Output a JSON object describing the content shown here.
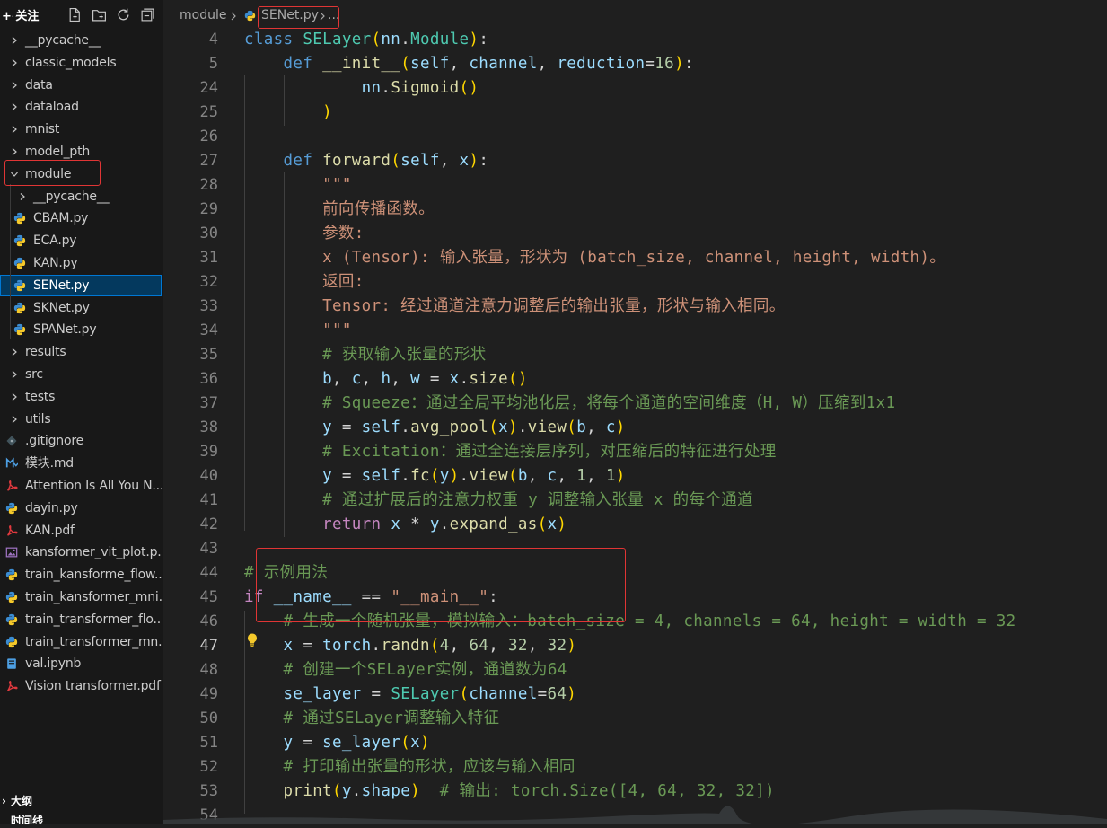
{
  "sidebar": {
    "brand": "+ 关注",
    "brand_ghost": "…",
    "header_icons": [
      "new-file-icon",
      "new-folder-icon",
      "refresh-icon",
      "collapse-all-icon"
    ],
    "tree": [
      {
        "label": "__pycache__",
        "kind": "folder",
        "expanded": false,
        "depth": 0
      },
      {
        "label": "classic_models",
        "kind": "folder",
        "expanded": false,
        "depth": 0
      },
      {
        "label": "data",
        "kind": "folder",
        "expanded": false,
        "depth": 0
      },
      {
        "label": "dataload",
        "kind": "folder",
        "expanded": false,
        "depth": 0
      },
      {
        "label": "mnist",
        "kind": "folder",
        "expanded": false,
        "depth": 0
      },
      {
        "label": "model_pth",
        "kind": "folder",
        "expanded": false,
        "depth": 0
      },
      {
        "label": "module",
        "kind": "folder",
        "expanded": true,
        "depth": 0
      },
      {
        "label": "__pycache__",
        "kind": "folder",
        "expanded": false,
        "depth": 1
      },
      {
        "label": "CBAM.py",
        "kind": "python",
        "depth": 1
      },
      {
        "label": "ECA.py",
        "kind": "python",
        "depth": 1
      },
      {
        "label": "KAN.py",
        "kind": "python",
        "depth": 1
      },
      {
        "label": "SENet.py",
        "kind": "python",
        "depth": 1,
        "selected": true
      },
      {
        "label": "SKNet.py",
        "kind": "python",
        "depth": 1
      },
      {
        "label": "SPANet.py",
        "kind": "python",
        "depth": 1
      },
      {
        "label": "results",
        "kind": "folder",
        "expanded": false,
        "depth": 0
      },
      {
        "label": "src",
        "kind": "folder",
        "expanded": false,
        "depth": 0
      },
      {
        "label": "tests",
        "kind": "folder",
        "expanded": false,
        "depth": 0
      },
      {
        "label": "utils",
        "kind": "folder",
        "expanded": false,
        "depth": 0
      },
      {
        "label": ".gitignore",
        "kind": "git",
        "depth": 0
      },
      {
        "label": "模块.md",
        "kind": "markdown",
        "depth": 0
      },
      {
        "label": "Attention Is All You N...",
        "kind": "pdf",
        "depth": 0
      },
      {
        "label": "dayin.py",
        "kind": "python",
        "depth": 0
      },
      {
        "label": "KAN.pdf",
        "kind": "pdf",
        "depth": 0
      },
      {
        "label": "kansformer_vit_plot.p...",
        "kind": "image",
        "depth": 0
      },
      {
        "label": "train_kansforme_flow...",
        "kind": "python",
        "depth": 0
      },
      {
        "label": "train_kansformer_mni...",
        "kind": "python",
        "depth": 0
      },
      {
        "label": "train_transformer_flo...",
        "kind": "python",
        "depth": 0
      },
      {
        "label": "train_transformer_mn...",
        "kind": "python",
        "depth": 0
      },
      {
        "label": "val.ipynb",
        "kind": "notebook",
        "depth": 0
      },
      {
        "label": "Vision transformer.pdf",
        "kind": "pdf",
        "depth": 0
      }
    ],
    "outline_label": "大纲",
    "timeline_label": "时间线"
  },
  "breadcrumb": {
    "folder": "module",
    "file": "SENet.py",
    "more": "..."
  },
  "editor": {
    "active_line": "47",
    "lines": [
      {
        "n": "4",
        "text": "class SELayer(nn.Module):"
      },
      {
        "n": "5",
        "text": "    def __init__(self, channel, reduction=16):"
      },
      {
        "n": "24",
        "text": "            nn.Sigmoid()"
      },
      {
        "n": "25",
        "text": "        )"
      },
      {
        "n": "26",
        "text": ""
      },
      {
        "n": "27",
        "text": "    def forward(self, x):"
      },
      {
        "n": "28",
        "text": "        \"\"\""
      },
      {
        "n": "29",
        "text": "        前向传播函数。"
      },
      {
        "n": "30",
        "text": "        参数:"
      },
      {
        "n": "31",
        "text": "        x (Tensor): 输入张量，形状为 (batch_size, channel, height, width)。"
      },
      {
        "n": "32",
        "text": "        返回:"
      },
      {
        "n": "33",
        "text": "        Tensor: 经过通道注意力调整后的输出张量，形状与输入相同。"
      },
      {
        "n": "34",
        "text": "        \"\"\""
      },
      {
        "n": "35",
        "text": "        # 获取输入张量的形状"
      },
      {
        "n": "36",
        "text": "        b, c, h, w = x.size()"
      },
      {
        "n": "37",
        "text": "        # Squeeze：通过全局平均池化层，将每个通道的空间维度（H, W）压缩到1x1"
      },
      {
        "n": "38",
        "text": "        y = self.avg_pool(x).view(b, c)"
      },
      {
        "n": "39",
        "text": "        # Excitation：通过全连接层序列，对压缩后的特征进行处理"
      },
      {
        "n": "40",
        "text": "        y = self.fc(y).view(b, c, 1, 1)"
      },
      {
        "n": "41",
        "text": "        # 通过扩展后的注意力权重 y 调整输入张量 x 的每个通道"
      },
      {
        "n": "42",
        "text": "        return x * y.expand_as(x)"
      },
      {
        "n": "43",
        "text": ""
      },
      {
        "n": "44",
        "text": "# 示例用法"
      },
      {
        "n": "45",
        "text": "if __name__ == \"__main__\":"
      },
      {
        "n": "46",
        "text": "    # 生成一个随机张量，模拟输入：batch_size = 4, channels = 64, height = width = 32"
      },
      {
        "n": "47",
        "text": "    x = torch.randn(4, 64, 32, 32)"
      },
      {
        "n": "48",
        "text": "    # 创建一个SELayer实例，通道数为64"
      },
      {
        "n": "49",
        "text": "    se_layer = SELayer(channel=64)"
      },
      {
        "n": "50",
        "text": "    # 通过SELayer调整输入特征"
      },
      {
        "n": "51",
        "text": "    y = se_layer(x)"
      },
      {
        "n": "52",
        "text": "    # 打印输出张量的形状，应该与输入相同"
      },
      {
        "n": "53",
        "text": "    print(y.shape)  # 输出: torch.Size([4, 64, 32, 32])"
      },
      {
        "n": "54",
        "text": ""
      }
    ]
  },
  "colors": {
    "editor_bg": "#1f1f1f",
    "sidebar_bg": "#181818",
    "selection": "#04395e",
    "annotation_red": "#e03535",
    "keyword": "#569cd6",
    "class": "#4ec9b0",
    "function": "#dcdcaa",
    "variable": "#9cdcfe",
    "number": "#b5cea8",
    "string": "#ce9178",
    "comment": "#6a9955"
  }
}
